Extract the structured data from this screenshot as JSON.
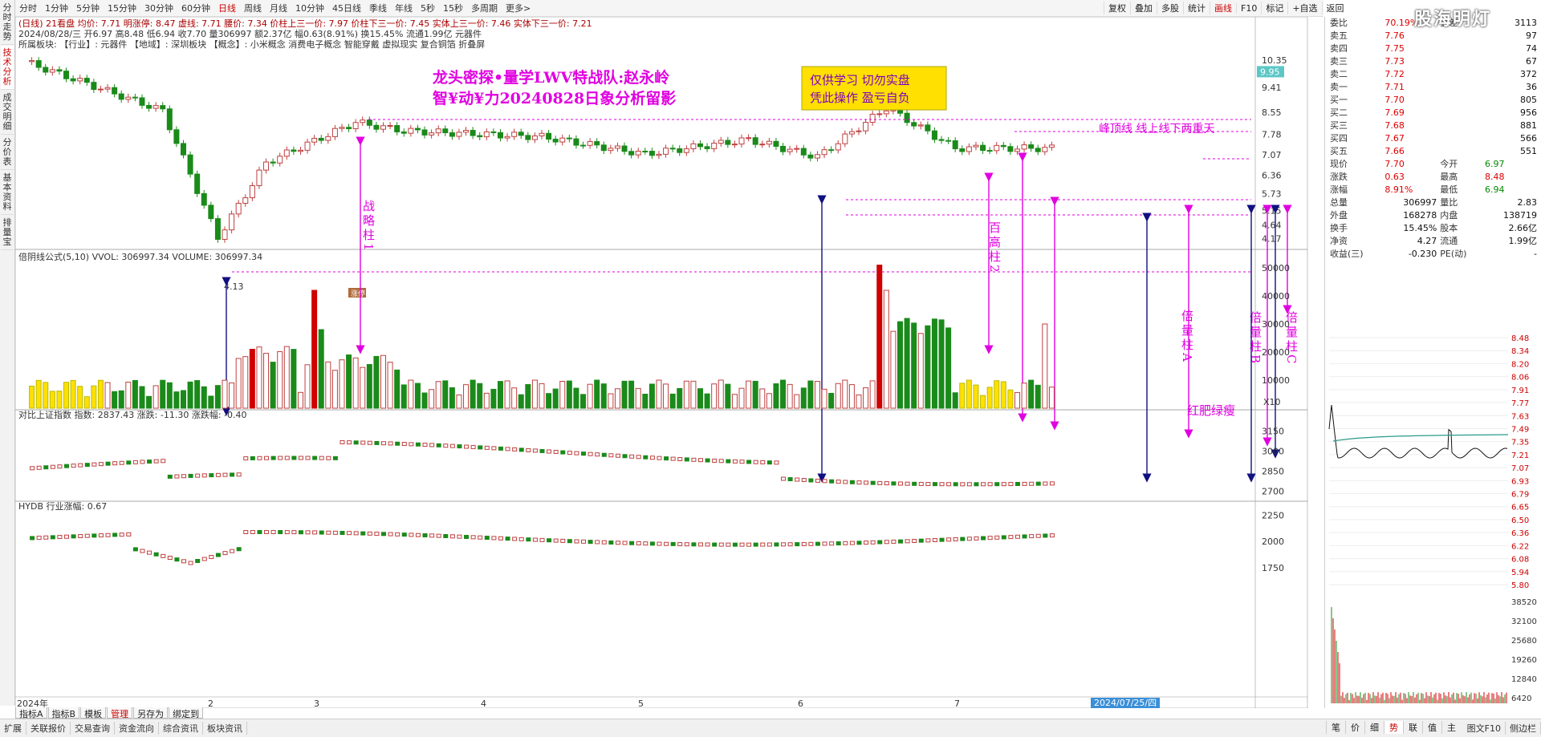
{
  "left_tabs": [
    "分时走势",
    "技术分析",
    "成交明细",
    "分价表",
    "基本资料",
    "排量宝"
  ],
  "periods": [
    "分时",
    "1分钟",
    "5分钟",
    "15分钟",
    "30分钟",
    "60分钟",
    "日线",
    "周线",
    "月线",
    "10分钟",
    "45日线",
    "季线",
    "年线",
    "5秒",
    "15秒",
    "多周期",
    "更多>"
  ],
  "active_period": "日线",
  "toolbar": [
    "复权",
    "叠加",
    "多股",
    "统计",
    "画线",
    "F10",
    "标记",
    "+自选",
    "返回"
  ],
  "active_tool": "画线",
  "header": {
    "line1": "(日线) 21看盘  均价: 7.71  明涨停: 8.47  虚线: 7.71  腰价: 7.34  价柱上三一价: 7.97  价柱下三一价: 7.45  实体上三一价: 7.46  实体下三一价: 7.21",
    "line2": "2024/08/28/三  开6.97 高8.48 低6.94 收7.70 量306997 额2.37亿 幅0.63(8.91%) 换15.45% 流通1.99亿 元器件",
    "line3": "所属板块:    【行业】: 元器件      【地域】: 深圳板块      【概念】: 小米概念 消费电子概念 智能穿戴 虚拟现实 复合铜箔 折叠屏"
  },
  "annotations": {
    "title1": "龙头密探•量学LWV特战队:赵永岭",
    "title2": "智¥动¥力20240828日象分析留影",
    "notice1": "仅供学习  切勿实盘",
    "notice2": "凭此操作  盈亏自负",
    "peak_note": "峰顶线 线上线下两重天",
    "label_strategy": "战略柱1",
    "label_hundred": "百高柱2",
    "label_times_a": "倍量柱A",
    "label_times_b": "倍量柱B",
    "label_times_c": "倍量柱C",
    "label_red_green": "红肥绿瘦",
    "low_price": "4.13",
    "badge_zt": "涨停",
    "badge_b": "B"
  },
  "price_axis": [
    "10.35",
    "9.41",
    "8.55",
    "7.78",
    "7.07",
    "6.36",
    "5.73",
    "5.15",
    "4.64",
    "4.17"
  ],
  "price_tag": "9.95",
  "vol_header": "倍阴线公式(5,10)  VVOL: 306997.34  VOLUME: 306997.34",
  "vol_axis": [
    "50000",
    "40000",
    "30000",
    "20000",
    "10000"
  ],
  "vol_x10": "X10",
  "idx_header": "对比上证指数  指数: 2837.43  涨跌: -11.30  涨跌幅: -0.40",
  "idx_axis": [
    "3150",
    "3000",
    "2850",
    "2700"
  ],
  "ind_header": "HYDB  行业涨幅: 0.67",
  "ind_axis": [
    "2250",
    "2000",
    "1750"
  ],
  "x_labels": [
    "2024年",
    "2",
    "3",
    "4",
    "5",
    "6",
    "7"
  ],
  "date_badge": "2024/07/25/四",
  "sec_tabs": [
    "指标A",
    "指标B",
    "模板",
    "管理",
    "另存为",
    "绑定到"
  ],
  "active_sec": "管理",
  "bottom_tabs": [
    "扩展",
    "关联报价",
    "交易查询",
    "资金流向",
    "综合资讯",
    "板块资讯"
  ],
  "bottom_right": [
    "图文F10",
    "侧边栏"
  ],
  "right_bottom_tabs": [
    "笔",
    "价",
    "细",
    "势",
    "联",
    "值",
    "主"
  ],
  "active_rb": "势",
  "quote": {
    "webi": {
      "label": "委比",
      "v1": "70.19%",
      "label2": "委差",
      "v2": "3113"
    },
    "asks": [
      {
        "l": "卖五",
        "p": "7.76",
        "v": "97"
      },
      {
        "l": "卖四",
        "p": "7.75",
        "v": "74"
      },
      {
        "l": "卖三",
        "p": "7.73",
        "v": "67"
      },
      {
        "l": "卖二",
        "p": "7.72",
        "v": "372"
      },
      {
        "l": "卖一",
        "p": "7.71",
        "v": "36"
      }
    ],
    "bids": [
      {
        "l": "买一",
        "p": "7.70",
        "v": "805"
      },
      {
        "l": "买二",
        "p": "7.69",
        "v": "956"
      },
      {
        "l": "买三",
        "p": "7.68",
        "v": "881"
      },
      {
        "l": "买四",
        "p": "7.67",
        "v": "566"
      },
      {
        "l": "买五",
        "p": "7.66",
        "v": "551"
      }
    ],
    "stats": [
      {
        "l1": "现价",
        "v1": "7.70",
        "l2": "今开",
        "v2": "6.97"
      },
      {
        "l1": "涨跌",
        "v1": "0.63",
        "l2": "最高",
        "v2": "8.48"
      },
      {
        "l1": "涨幅",
        "v1": "8.91%",
        "l2": "最低",
        "v2": "6.94"
      },
      {
        "l1": "总量",
        "v1": "306997",
        "l2": "量比",
        "v2": "2.83"
      },
      {
        "l1": "外盘",
        "v1": "168278",
        "l2": "内盘",
        "v2": "138719"
      },
      {
        "l1": "换手",
        "v1": "15.45%",
        "l2": "股本",
        "v2": "2.66亿"
      },
      {
        "l1": "净资",
        "v1": "4.27",
        "l2": "流通",
        "v2": "1.99亿"
      },
      {
        "l1": "收益(三)",
        "v1": "-0.230",
        "l2": "PE(动)",
        "v2": "-"
      }
    ]
  },
  "mini_price_axis": [
    "8.48",
    "8.34",
    "8.20",
    "8.06",
    "7.91",
    "7.77",
    "7.63",
    "7.49",
    "7.35",
    "7.21",
    "7.07",
    "6.93",
    "6.79",
    "6.65",
    "6.50",
    "6.36",
    "6.22",
    "6.08",
    "5.94",
    "5.80"
  ],
  "mini_vol_axis": [
    "38520",
    "32100",
    "25680",
    "19260",
    "12840",
    "6420"
  ],
  "watermark": "股海明灯",
  "colors": {
    "up": "#d00000",
    "down": "#1a8a1a",
    "up_hollow": "#c04040",
    "magenta": "#e000e0",
    "navy": "#101080",
    "yellow": "#ffe000"
  }
}
